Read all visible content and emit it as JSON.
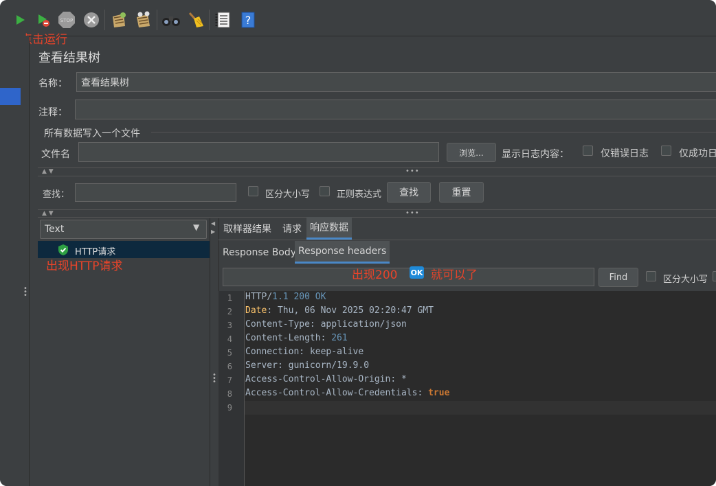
{
  "toolbar": {
    "buttons": [
      {
        "name": "start-icon"
      },
      {
        "name": "start-no-pause-icon"
      },
      {
        "name": "stop-icon"
      },
      {
        "name": "shutdown-icon"
      },
      {
        "name": "clear-icon"
      },
      {
        "name": "clear-all-icon"
      },
      {
        "name": "search-binoculars-icon"
      },
      {
        "name": "reset-search-broom-icon"
      },
      {
        "name": "function-helper-icon"
      },
      {
        "name": "help-icon"
      }
    ],
    "annotation": "点击运行"
  },
  "panel": {
    "title": "查看结果树",
    "name_label": "名称：",
    "name_value": "查看结果树",
    "comment_label": "注释：",
    "comment_value": "",
    "file_section_label": "所有数据写入一个文件",
    "filename_label": "文件名",
    "filename_value": "",
    "browse_button": "浏览...",
    "log_content_label": "显示日志内容：",
    "errors_only_label": "仅错误日志",
    "success_only_label": "仅成功日"
  },
  "search": {
    "label": "查找：",
    "value": "",
    "case_label": "区分大小写",
    "regex_label": "正则表达式",
    "find_button": "查找",
    "reset_button": "重置"
  },
  "tree": {
    "renderer": "Text",
    "items": [
      {
        "label": "HTTP请求",
        "status": "success"
      }
    ],
    "annotation": "出现HTTP请求"
  },
  "result_tabs": {
    "tabs": [
      "取样器结果",
      "请求",
      "响应数据"
    ],
    "active": "响应数据",
    "subtabs": [
      "Response Body",
      "Response headers"
    ],
    "active_subtab": "Response headers"
  },
  "response_search": {
    "value": "",
    "find_button": "Find",
    "case_label": "区分大小写"
  },
  "annotation_ok": {
    "before": "出现200",
    "badge": "OK",
    "after": "就可以了"
  },
  "response_headers": {
    "line_numbers": [
      "1",
      "2",
      "3",
      "4",
      "5",
      "6",
      "7",
      "8",
      "9"
    ],
    "lines": [
      {
        "key": "HTTP",
        "sep": "/",
        "value": "1.1 200 OK"
      },
      {
        "key": "Date",
        "sep": ": ",
        "value": "Thu, 06 Nov 2025 02:20:47 GMT"
      },
      {
        "key": "Content-Type",
        "sep": ": ",
        "value": "application/json"
      },
      {
        "key": "Content-Length",
        "sep": ": ",
        "value": "261"
      },
      {
        "key": "Connection",
        "sep": ": ",
        "value": "keep-alive"
      },
      {
        "key": "Server",
        "sep": ": ",
        "value": "gunicorn/19.9.0"
      },
      {
        "key": "Access-Control-Allow-Origin",
        "sep": ": ",
        "value": "*"
      },
      {
        "key": "Access-Control-Allow-Credentials",
        "sep": ": ",
        "value": "true"
      },
      {
        "key": "",
        "sep": "",
        "value": ""
      }
    ]
  },
  "colors": {
    "background": "#3c3f41",
    "editor_bg": "#2b2b2b",
    "accent": "#4a88c7",
    "annotation": "#e8442a",
    "success_icon": "#2ea043"
  }
}
